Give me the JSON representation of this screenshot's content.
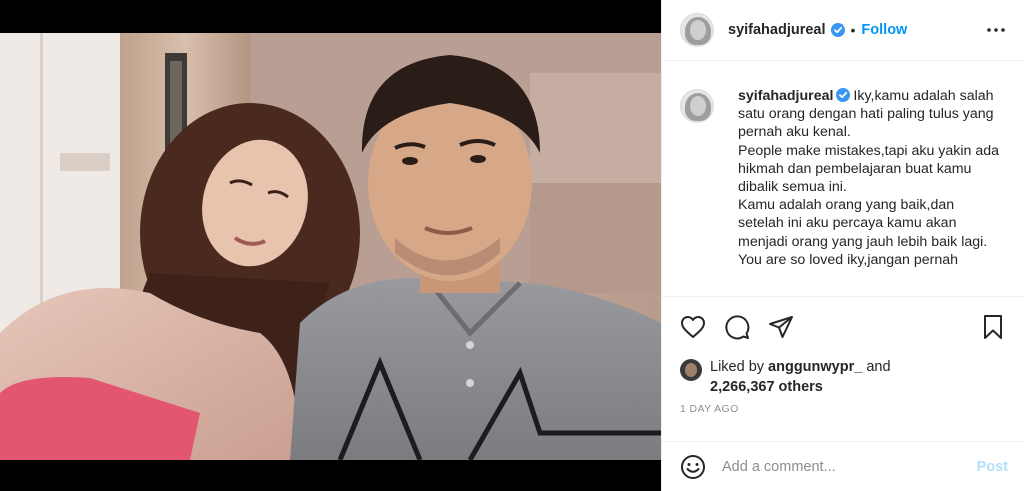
{
  "post": {
    "username": "syifahadjureal",
    "follow_label": "Follow",
    "separator": "•"
  },
  "caption": {
    "username": "syifahadjureal",
    "lines": [
      "Iky,kamu adalah salah",
      "satu orang dengan hati paling tulus yang",
      "pernah aku kenal.",
      "People make mistakes,tapi aku yakin ada",
      "hikmah dan pembelajaran buat kamu",
      "dibalik semua ini.",
      "Kamu adalah orang yang baik,dan",
      "setelah ini aku percaya kamu akan",
      "menjadi orang yang jauh lebih baik lagi.",
      "You are so loved iky,jangan pernah"
    ]
  },
  "likes": {
    "prefix": "Liked by",
    "user": "anggunwypr_",
    "conjunction": "and",
    "count": "2,266,367 others"
  },
  "timestamp": "1 DAY AGO",
  "comment": {
    "placeholder": "Add a comment...",
    "post_label": "Post"
  },
  "colors": {
    "accent": "#0095f6",
    "post_disabled": "#b2dffc",
    "muted": "#8e8e8e",
    "verified": "#3897f0"
  },
  "icons": {
    "more": "more-options-icon",
    "like": "heart-icon",
    "comment": "comment-icon",
    "share": "share-icon",
    "save": "bookmark-icon",
    "emoji": "emoji-icon",
    "verified": "verified-badge-icon"
  }
}
